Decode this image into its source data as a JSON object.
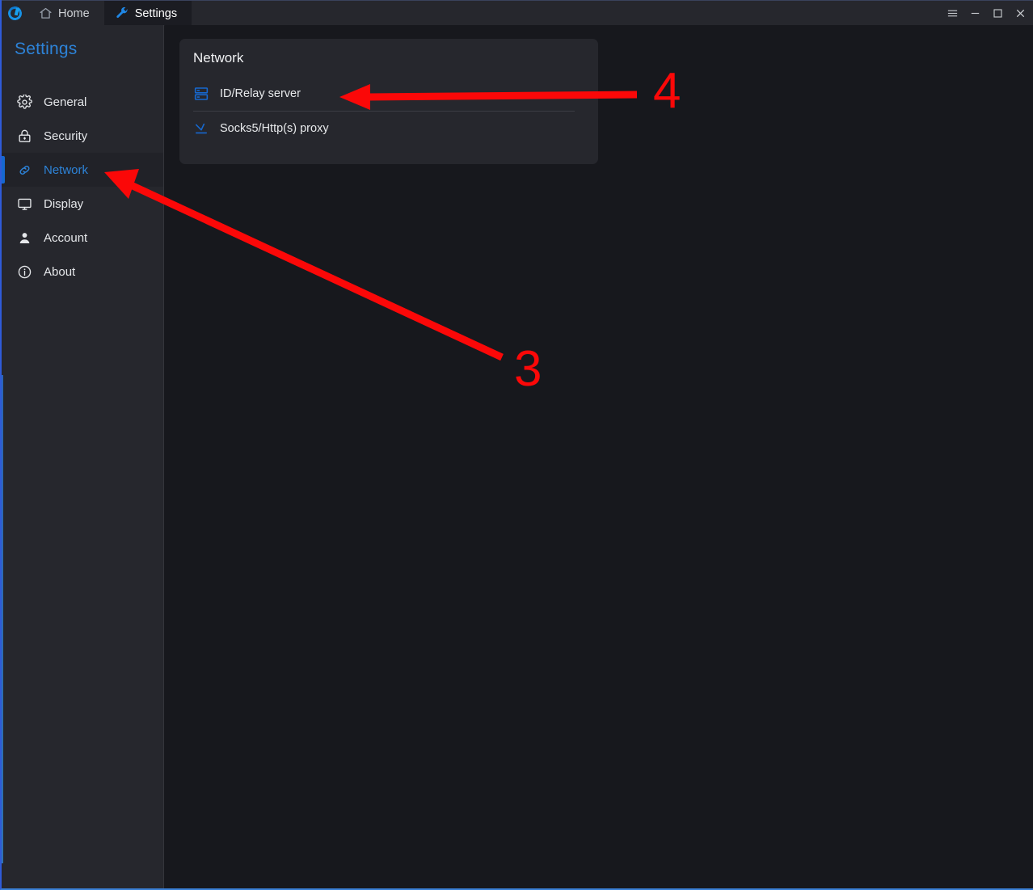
{
  "app": {
    "logo_icon": "rustdesk-logo-icon",
    "accent_color": "#1668d0",
    "annotation_color": "#fb0808",
    "background_color": "#17181d",
    "panel_color": "#26272d"
  },
  "titlebar": {
    "tabs": [
      {
        "label": "Home",
        "icon": "home-icon",
        "active": false
      },
      {
        "label": "Settings",
        "icon": "wrench-icon",
        "active": true
      }
    ],
    "controls": [
      {
        "name": "menu-button",
        "icon": "hamburger-menu-icon"
      },
      {
        "name": "minimize-button",
        "icon": "minimize-icon"
      },
      {
        "name": "maximize-button",
        "icon": "maximize-icon"
      },
      {
        "name": "close-button",
        "icon": "close-icon"
      }
    ]
  },
  "sidebar": {
    "title": "Settings",
    "items": [
      {
        "label": "General",
        "icon": "gear-icon",
        "selected": false
      },
      {
        "label": "Security",
        "icon": "lock-icon",
        "selected": false
      },
      {
        "label": "Network",
        "icon": "link-icon",
        "selected": true
      },
      {
        "label": "Display",
        "icon": "monitor-icon",
        "selected": false
      },
      {
        "label": "Account",
        "icon": "person-icon",
        "selected": false
      },
      {
        "label": "About",
        "icon": "info-icon",
        "selected": false
      }
    ]
  },
  "main": {
    "card": {
      "title": "Network",
      "rows": [
        {
          "label": "ID/Relay server",
          "icon": "server-rack-icon"
        },
        {
          "label": "Socks5/Http(s) proxy",
          "icon": "proxy-arrow-icon"
        }
      ]
    }
  },
  "annotations": [
    {
      "number": "4",
      "points_to": "ID/Relay server"
    },
    {
      "number": "3",
      "points_to": "Network"
    }
  ]
}
